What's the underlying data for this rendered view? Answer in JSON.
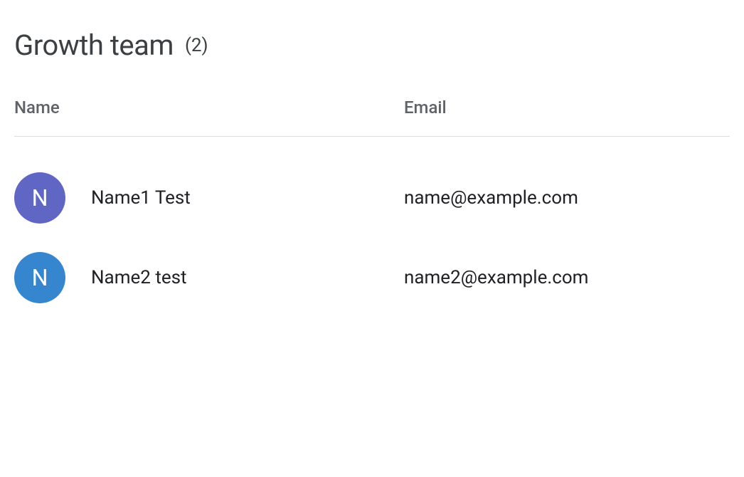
{
  "header": {
    "title": "Growth team",
    "count_label": "(2)"
  },
  "table": {
    "columns": {
      "name": "Name",
      "email": "Email"
    },
    "rows": [
      {
        "avatar_initial": "N",
        "avatar_color": "#6066c4",
        "name": "Name1 Test",
        "email": "name@example.com"
      },
      {
        "avatar_initial": "N",
        "avatar_color": "#3586cf",
        "name": "Name2 test",
        "email": "name2@example.com"
      }
    ]
  }
}
